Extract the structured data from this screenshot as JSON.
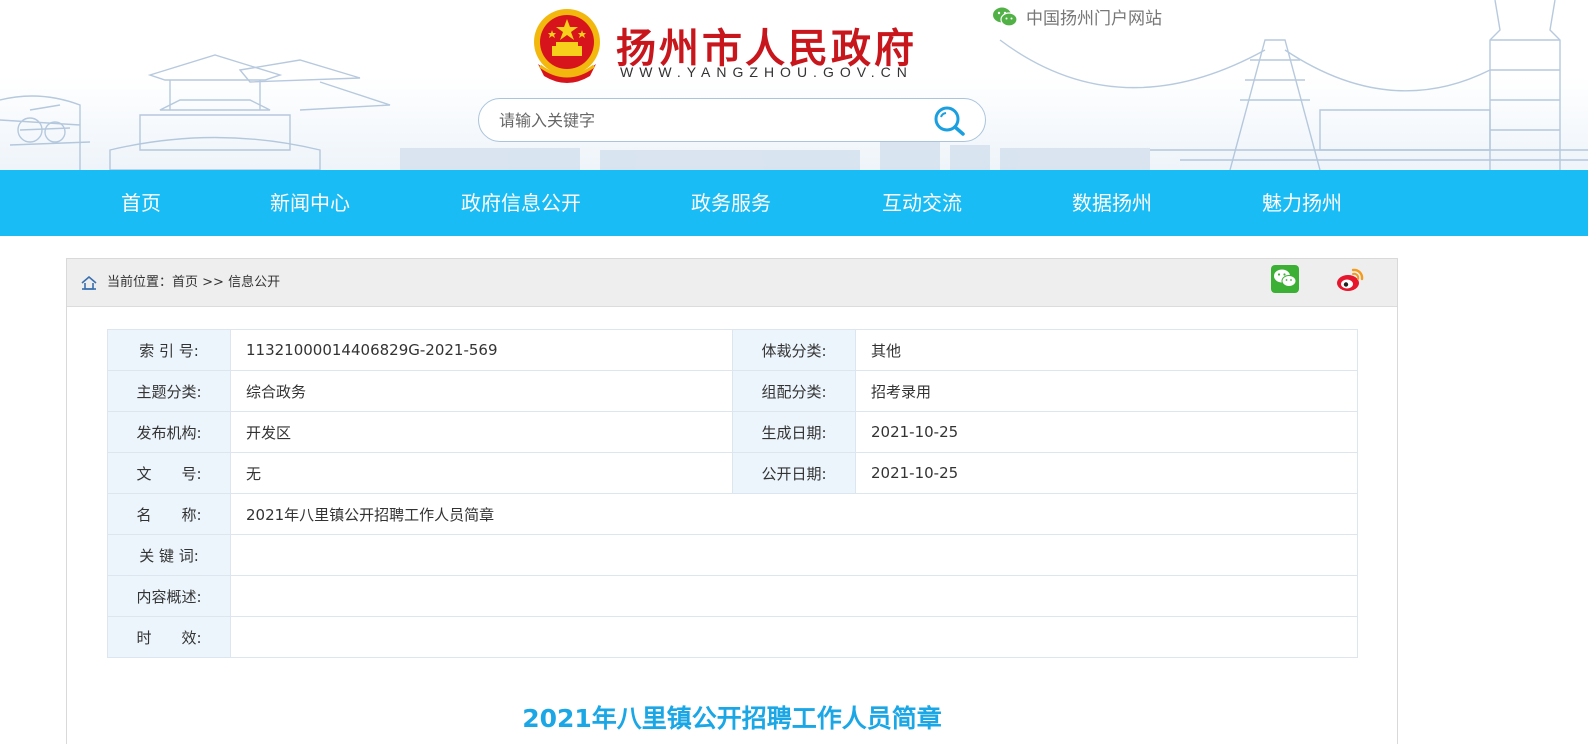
{
  "header": {
    "site_title": "扬州市人民政府",
    "site_url": "WWW.YANGZHOU.GOV.CN",
    "portal_link": "中国扬州门户网站",
    "search_placeholder": "请输入关键字"
  },
  "nav": {
    "items": [
      "首页",
      "新闻中心",
      "政府信息公开",
      "政务服务",
      "互动交流",
      "数据扬州",
      "魅力扬州"
    ]
  },
  "breadcrumb": {
    "prefix": "当前位置：",
    "home": "首页",
    "separator": " >> ",
    "current": "信息公开"
  },
  "info": {
    "index_label": "索 引 号:",
    "index_value": "11321000014406829G-2021-569",
    "genre_label": "体裁分类:",
    "genre_value": "其他",
    "topic_label": "主题分类:",
    "topic_value": "综合政务",
    "assign_label": "组配分类:",
    "assign_value": "招考录用",
    "publisher_label": "发布机构:",
    "publisher_value": "开发区",
    "created_label": "生成日期:",
    "created_value": "2021-10-25",
    "docno_label": "文　　号:",
    "docno_value": "无",
    "opened_label": "公开日期:",
    "opened_value": "2021-10-25",
    "name_label": "名　　称:",
    "name_value": "2021年八里镇公开招聘工作人员简章",
    "keywords_label": "关 键 词:",
    "keywords_value": "",
    "summary_label": "内容概述:",
    "summary_value": "",
    "validity_label": "时　　效:",
    "validity_value": ""
  },
  "document": {
    "title": "2021年八里镇公开招聘工作人员简章"
  },
  "colors": {
    "nav_bg": "#1abcf5",
    "title_red": "#c8161d",
    "doc_title_blue": "#1ba7e6",
    "label_bg": "#ecf5fc"
  },
  "icons": [
    "emblem-icon",
    "wechat-icon",
    "search-icon",
    "home-icon",
    "wechat-share-icon",
    "weibo-share-icon"
  ]
}
